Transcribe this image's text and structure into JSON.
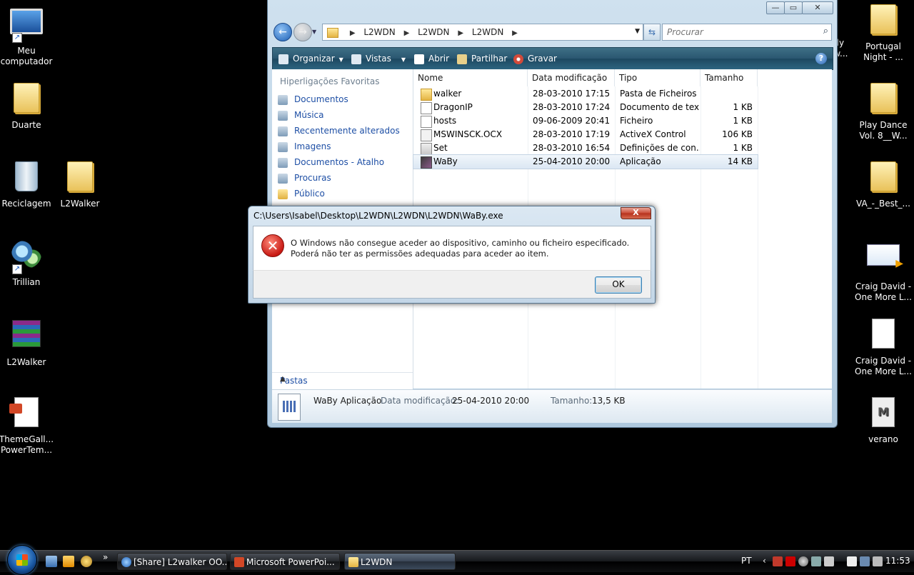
{
  "desktop": {
    "icons_left": [
      {
        "label": "Meu\ncomputador",
        "name": "my-computer"
      },
      {
        "label": "Duarte",
        "name": "duarte-folder"
      },
      {
        "label": "Reciclagem",
        "name": "recycle-bin"
      },
      {
        "label": "L2Walker",
        "name": "l2walker-folder"
      },
      {
        "label": "Trillian",
        "name": "trillian"
      },
      {
        "label": "L2Walker",
        "name": "l2walker-archive"
      },
      {
        "label": "ThemeGall...\nPowerTem...",
        "name": "themegallery"
      }
    ],
    "icons_right": [
      {
        "label": "Portugal\nNight - ...",
        "name": "portugal-night"
      },
      {
        "label": "Play Dance\nVol. 8__W...",
        "name": "play-dance"
      },
      {
        "label": "VA_-_Best_...",
        "name": "va-best"
      },
      {
        "label": "Craig David -\nOne More L...",
        "name": "craig-david-1"
      },
      {
        "label": "Craig David -\nOne More L...",
        "name": "craig-david-2"
      },
      {
        "label": "verano",
        "name": "verano"
      }
    ],
    "partial_label": "ody\now..."
  },
  "explorer": {
    "window_controls": {
      "minimize": "—",
      "maximize": "▭",
      "close": "✕"
    },
    "breadcrumb": [
      "L2WDN",
      "L2WDN",
      "L2WDN"
    ],
    "search_placeholder": "Procurar",
    "toolbar": {
      "organize": "Organizar",
      "views": "Vistas",
      "open": "Abrir",
      "share": "Partilhar",
      "burn": "Gravar",
      "help": "?"
    },
    "favorites_title": "Hiperligações Favoritas",
    "favorites": [
      "Documentos",
      "Música",
      "Recentemente alterados",
      "Imagens",
      "Documentos - Atalho",
      "Procuras",
      "Público"
    ],
    "folders_label": "Pastas",
    "columns": [
      "Nome",
      "Data modificação",
      "Tipo",
      "Tamanho"
    ],
    "files": [
      {
        "name": "walker",
        "date": "28-03-2010 17:15",
        "type": "Pasta de Ficheiros",
        "size": "",
        "icon": "folder-icon"
      },
      {
        "name": "DragonIP",
        "date": "28-03-2010 17:24",
        "type": "Documento de tex...",
        "size": "1 KB",
        "icon": "text-file-icon"
      },
      {
        "name": "hosts",
        "date": "09-06-2009 20:41",
        "type": "Ficheiro",
        "size": "1 KB",
        "icon": "file-icon"
      },
      {
        "name": "MSWINSCK.OCX",
        "date": "28-03-2010 17:19",
        "type": "ActiveX Control",
        "size": "106 KB",
        "icon": "activex-icon"
      },
      {
        "name": "Set",
        "date": "28-03-2010 16:54",
        "type": "Definições de con...",
        "size": "1 KB",
        "icon": "settings-file-icon"
      },
      {
        "name": "WaBy",
        "date": "25-04-2010 20:00",
        "type": "Aplicação",
        "size": "14 KB",
        "icon": "application-icon"
      }
    ],
    "selected_file": "WaBy",
    "details": {
      "title": "WaBy Aplicação",
      "modified_label": "Data modificação:",
      "modified_value": "25-04-2010 20:00",
      "size_label": "Tamanho:",
      "size_value": "13,5 KB"
    }
  },
  "dialog": {
    "title": "C:\\Users\\Isabel\\Desktop\\L2WDN\\L2WDN\\L2WDN\\WaBy.exe",
    "message": "O Windows não consegue aceder ao dispositivo, caminho ou ficheiro especificado. Poderá não ter as permissões adequadas para aceder ao item.",
    "ok": "OK",
    "close": "X"
  },
  "taskbar": {
    "buttons": [
      {
        "label": "[Share] L2walker OO...",
        "icon": "internet-explorer-icon"
      },
      {
        "label": "Microsoft PowerPoi...",
        "icon": "powerpoint-icon"
      },
      {
        "label": "L2WDN",
        "icon": "folder-icon"
      }
    ],
    "language": "PT",
    "chevron": "»",
    "tray_expand": "‹",
    "clock": "11:53"
  }
}
